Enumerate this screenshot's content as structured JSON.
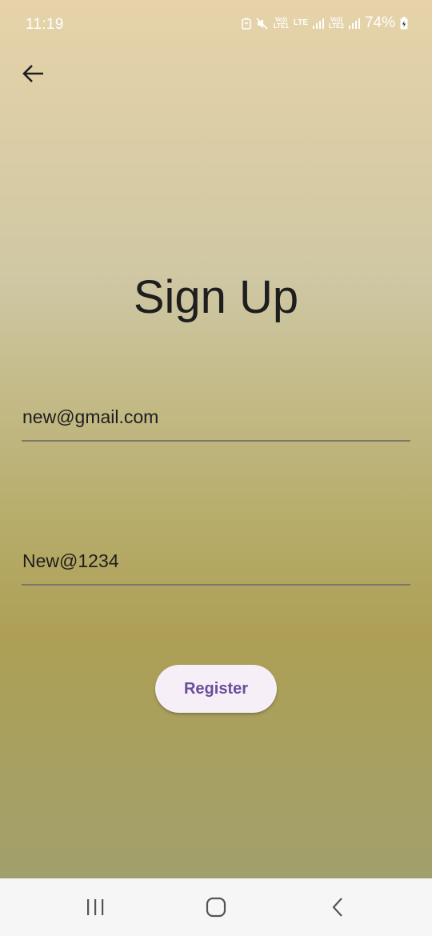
{
  "status_bar": {
    "time": "11:19",
    "sim1_label_top": "Vo))",
    "sim1_label_bottom": "LTE1",
    "lte_label": "LTE",
    "sim2_label_top": "Vo))",
    "sim2_label_bottom": "LTE2",
    "battery_percent": "74%"
  },
  "header": {
    "back_icon": "arrow-left-icon"
  },
  "main": {
    "title": "Sign Up",
    "email_value": "new@gmail.com",
    "password_value": "New@1234",
    "register_label": "Register"
  },
  "nav_bar": {
    "recents_icon": "recents-icon",
    "home_icon": "home-icon",
    "back_icon": "back-chevron-icon"
  },
  "colors": {
    "accent_text": "#6a4d9c",
    "button_bg": "#f6eff8",
    "underline": "#7d7768"
  }
}
